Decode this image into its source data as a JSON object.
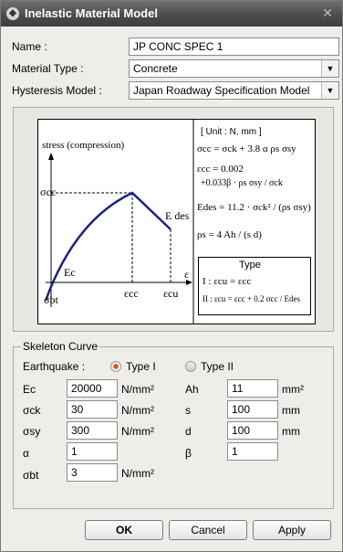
{
  "window": {
    "title": "Inelastic Material Model",
    "close_glyph": "✕"
  },
  "form": {
    "name_label": "Name :",
    "name_value": "JP CONC SPEC 1",
    "material_type_label": "Material Type :",
    "material_type_value": "Concrete",
    "hysteresis_label": "Hysteresis Model :",
    "hysteresis_value": "Japan Roadway Specification Model"
  },
  "diagram": {
    "stress_label": "stress (compression)",
    "sigma_cc": "σcc",
    "e_des": "E des",
    "ec": "Ec",
    "sigma_bt": "σbt",
    "eps_cc": "εcc",
    "eps_cu": "εcu",
    "eps": "ε",
    "units": "[ Unit : N, mm ]",
    "eq1": "σcc = σck + 3.8 α ρs σsy",
    "eq2a": "εcc = 0.002",
    "eq2b": "+0.033β · ρs σsy / σck",
    "eq3": "Edes = 11.2 · σck² / (ρs σsy)",
    "eq4": "ρs = 4 Ah / (s d)",
    "type_title": "Type",
    "type1": "I : εcu = εcc",
    "type2": "II : εcu = εcc + 0.2 σcc / Edes"
  },
  "skeleton": {
    "title": "Skeleton Curve",
    "earthquake_label": "Earthquake :",
    "type1_label": "Type I",
    "type2_label": "Type II",
    "selected": "Type I",
    "ec_label": "Ec",
    "ec_value": "20000",
    "ec_unit": "N/mm²",
    "sck_label": "σck",
    "sck_value": "30",
    "sck_unit": "N/mm²",
    "ssy_label": "σsy",
    "ssy_value": "300",
    "ssy_unit": "N/mm²",
    "alpha_label": "α",
    "alpha_value": "1",
    "sbt_label": "σbt",
    "sbt_value": "3",
    "sbt_unit": "N/mm²",
    "ah_label": "Ah",
    "ah_value": "11",
    "ah_unit": "mm²",
    "s_label": "s",
    "s_value": "100",
    "s_unit": "mm",
    "d_label": "d",
    "d_value": "100",
    "d_unit": "mm",
    "beta_label": "β",
    "beta_value": "1"
  },
  "buttons": {
    "ok": "OK",
    "cancel": "Cancel",
    "apply": "Apply"
  }
}
